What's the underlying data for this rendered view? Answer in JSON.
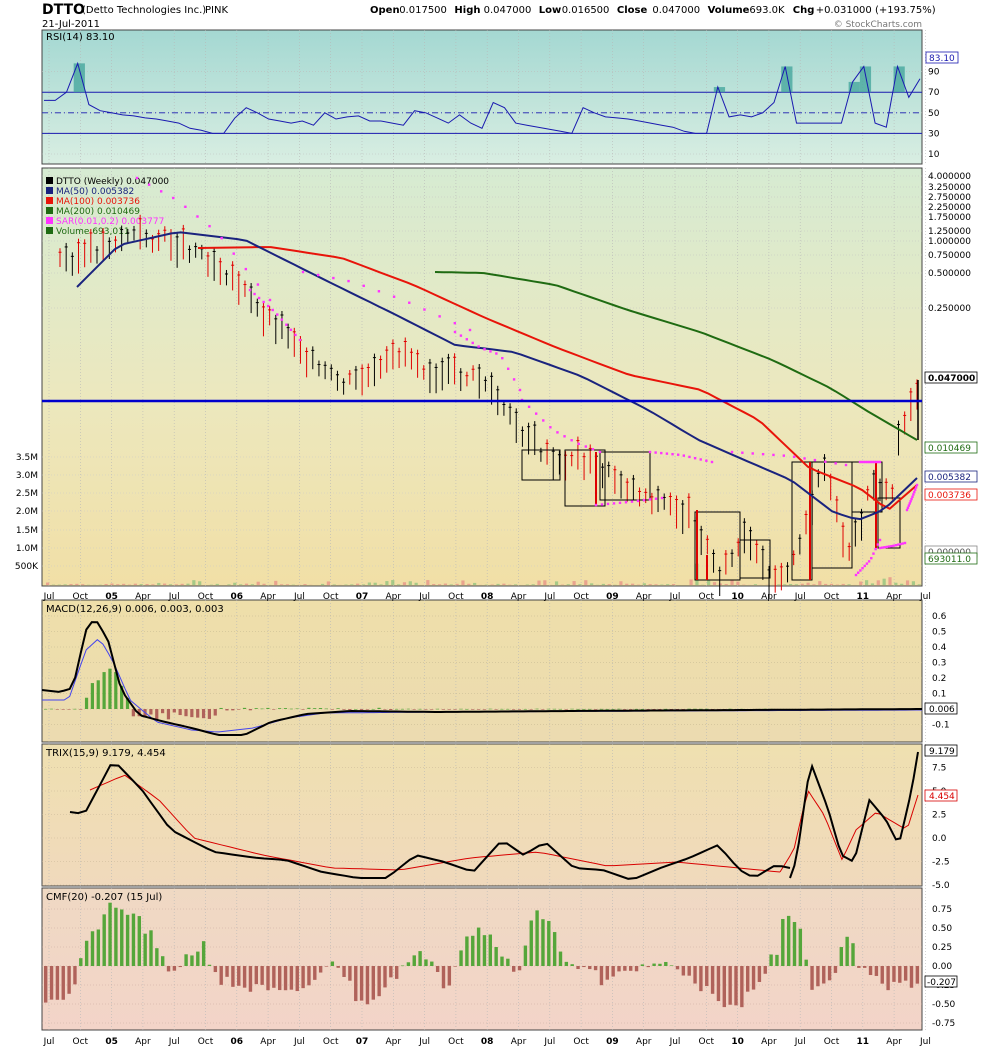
{
  "header": {
    "symbol": "DTTO",
    "company": "(Detto Technologies Inc.)",
    "exchange": "PINK",
    "date": "21-Jul-2011",
    "watermark": "© StockCharts.com",
    "quote": [
      {
        "label": "Open",
        "value": "0.017500"
      },
      {
        "label": "High",
        "value": "0.047000"
      },
      {
        "label": "Low",
        "value": "0.016500"
      },
      {
        "label": "Close",
        "value": "0.047000"
      },
      {
        "label": "Volume",
        "value": "693.0K"
      },
      {
        "label": "Chg",
        "value": "+0.031000 (+193.75%)"
      }
    ]
  },
  "x_axis": {
    "labels": [
      "Jul",
      "Oct",
      "05",
      "Apr",
      "Jul",
      "Oct",
      "06",
      "Apr",
      "Jul",
      "Oct",
      "07",
      "Apr",
      "Jul",
      "Oct",
      "08",
      "Apr",
      "Jul",
      "Oct",
      "09",
      "Apr",
      "Jul",
      "Oct",
      "10",
      "Apr",
      "Jul",
      "Oct",
      "11",
      "Apr",
      "Jul"
    ],
    "bold": [
      "05",
      "06",
      "07",
      "08",
      "09",
      "10",
      "11"
    ]
  },
  "colors": {
    "up_candle": "#000000",
    "down_candle": "#e00000",
    "ma50": "#1a237e",
    "ma100": "#e8140a",
    "ma200": "#1f6b12",
    "sar": "#ff33ff",
    "hline": "#0000cc",
    "histogram_up": "#55a63a",
    "histogram_down": "#b0625a",
    "signal": "#d80000"
  },
  "chart_data": [
    {
      "type": "line",
      "panel": "rsi",
      "title": "RSI(14) 83.10",
      "series": [
        {
          "name": "RSI(14)",
          "last": 83.1
        }
      ],
      "y_ticks": [
        90,
        70,
        50,
        30,
        10
      ],
      "levels": [
        70,
        30
      ],
      "last_label": "83.10",
      "approx_values": [
        62,
        62,
        70,
        98,
        58,
        52,
        50,
        48,
        47,
        45,
        44,
        42,
        40,
        35,
        33,
        30,
        30,
        45,
        55,
        50,
        44,
        42,
        40,
        42,
        38,
        50,
        44,
        46,
        47,
        42,
        42,
        40,
        38,
        52,
        50,
        45,
        40,
        48,
        40,
        35,
        60,
        55,
        40,
        38,
        36,
        34,
        32,
        30,
        55,
        50,
        46,
        45,
        44,
        42,
        40,
        38,
        36,
        32,
        30,
        30,
        75,
        46,
        48,
        46,
        50,
        60,
        95,
        40,
        40,
        40,
        40,
        40,
        80,
        95,
        40,
        36,
        95,
        65,
        83.1
      ]
    },
    {
      "type": "line",
      "panel": "price",
      "title": "DTTO (Weekly) 0.047000",
      "log_scale": true,
      "legend_placement": "top-left",
      "legend": [
        {
          "text": "DTTO (Weekly) 0.047000",
          "color": "#000000"
        },
        {
          "text": "MA(50) 0.005382",
          "color": "#1a237e"
        },
        {
          "text": "MA(100) 0.003736",
          "color": "#e8140a"
        },
        {
          "text": "MA(200) 0.010469",
          "color": "#1f6b12"
        },
        {
          "text": "SAR(0.01,0.2) 0.003777",
          "color": "#ff33ff"
        },
        {
          "text": "Volume 693,011",
          "color": "#1f6b12"
        }
      ],
      "y_ticks": [
        "4.000000",
        "3.250000",
        "2.750000",
        "2.250000",
        "1.750000",
        "1.250000",
        "1.000000",
        "0.750000",
        "0.500000",
        "0.250000"
      ],
      "horizontal_line_label": "",
      "end_labels": [
        {
          "text": "0.047000",
          "fill": "#ffffff",
          "stroke": "#000000",
          "color": "#000000"
        },
        {
          "text": "0.010469",
          "fill": "#ffffff",
          "stroke": "#1f6b12",
          "color": "#1f6b12"
        },
        {
          "text": "0.005382",
          "fill": "#ffffff",
          "stroke": "#1a237e",
          "color": "#1a237e"
        },
        {
          "text": "0.003736",
          "fill": "#ffffff",
          "stroke": "#e8140a",
          "color": "#e8140a"
        },
        {
          "text": "0.000000",
          "fill": "#ffffff",
          "stroke": "#888888",
          "color": "#555555"
        },
        {
          "text": "693011.0",
          "fill": "#ffffff",
          "stroke": "#1f6b12",
          "color": "#1f6b12"
        }
      ],
      "series": [
        {
          "name": "MA(50)",
          "last": 0.005382
        },
        {
          "name": "MA(100)",
          "last": 0.003736
        },
        {
          "name": "MA(200)",
          "last": 0.010469
        },
        {
          "name": "SAR(0.01,0.2)",
          "last": 0.003777
        },
        {
          "name": "Volume",
          "last": 693011
        }
      ],
      "volume_ticks": [
        "3.5M",
        "3.0M",
        "2.5M",
        "2.0M",
        "1.5M",
        "1.0M",
        "500K"
      ]
    },
    {
      "type": "line",
      "panel": "macd",
      "title": "MACD(12,26,9) 0.006, 0.003, 0.003",
      "series": [
        {
          "name": "MACD(12,26,9)",
          "last": 0.006
        },
        {
          "name": "Signal",
          "last": 0.003
        },
        {
          "name": "Histogram",
          "last": 0.003
        }
      ],
      "y_ticks": [
        "0.6",
        "0.5",
        "0.4",
        "0.3",
        "0.2",
        "0.1",
        "0.0",
        "-0.1"
      ],
      "last_label": "0.006"
    },
    {
      "type": "line",
      "panel": "trix",
      "title": "TRIX(15,9) 9.179, 4.454",
      "series": [
        {
          "name": "TRIX(15,9)",
          "last": 9.179
        },
        {
          "name": "Signal",
          "last": 4.454
        }
      ],
      "y_ticks": [
        "7.5",
        "5.0",
        "2.5",
        "0.0",
        "-2.5",
        "-5.0"
      ],
      "last_labels": [
        "9.179",
        "4.454"
      ]
    },
    {
      "type": "bar",
      "panel": "cmf",
      "title": "CMF(20) -0.207 (15 Jul)",
      "series": [
        {
          "name": "CMF(20)",
          "last": -0.207
        }
      ],
      "y_ticks": [
        "0.75",
        "0.50",
        "0.25",
        "0.00",
        "-0.25",
        "-0.50",
        "-0.75"
      ],
      "last_label": "-0.207"
    }
  ]
}
